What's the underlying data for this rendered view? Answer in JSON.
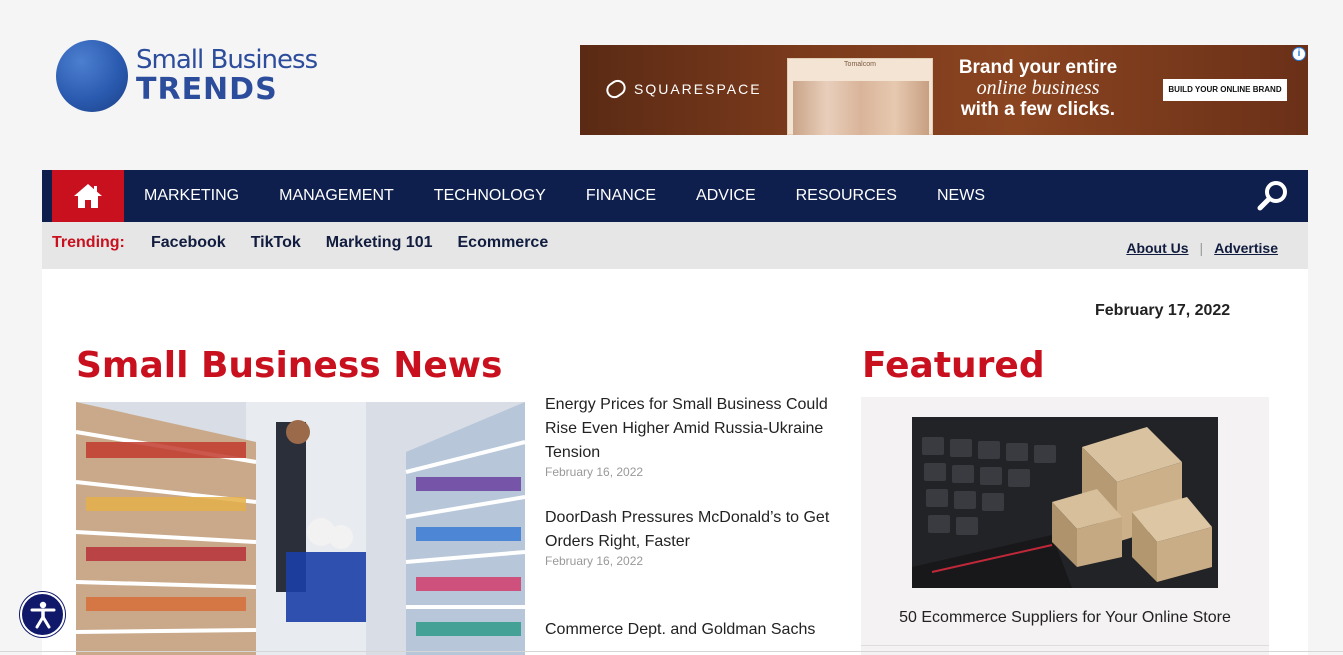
{
  "logo": {
    "line1": "Small Business",
    "line2": "TRENDS"
  },
  "ad": {
    "brand": "SQUARESPACE",
    "photo_header": "Tomalcom",
    "headline_1": "Brand your entire",
    "headline_2": "online business",
    "headline_3": "with a few clicks.",
    "cta": "BUILD YOUR ONLINE BRAND",
    "info": "i"
  },
  "nav": {
    "items": [
      "MARKETING",
      "MANAGEMENT",
      "TECHNOLOGY",
      "FINANCE",
      "ADVICE",
      "RESOURCES",
      "NEWS"
    ]
  },
  "trending": {
    "label": "Trending:",
    "links": [
      "Facebook",
      "TikTok",
      "Marketing 101",
      "Ecommerce"
    ],
    "about": "About Us",
    "separator": "|",
    "advertise": "Advertise"
  },
  "date": "February 17, 2022",
  "news": {
    "title": "Small Business News",
    "items": [
      {
        "headline": "Energy Prices for Small Business Could Rise Even Higher Amid Russia-Ukraine Tension",
        "date": "February 16, 2022"
      },
      {
        "headline": "DoorDash Pressures McDonald’s to Get Orders Right, Faster",
        "date": "February 16, 2022"
      },
      {
        "headline": "Commerce Dept. and Goldman Sachs",
        "date": ""
      }
    ]
  },
  "featured": {
    "title": "Featured",
    "caption": "50 Ecommerce Suppliers for Your Online Store"
  },
  "colors": {
    "navy": "#0f1f4d",
    "red": "#c8101e",
    "logo_blue": "#2c4c9c"
  }
}
